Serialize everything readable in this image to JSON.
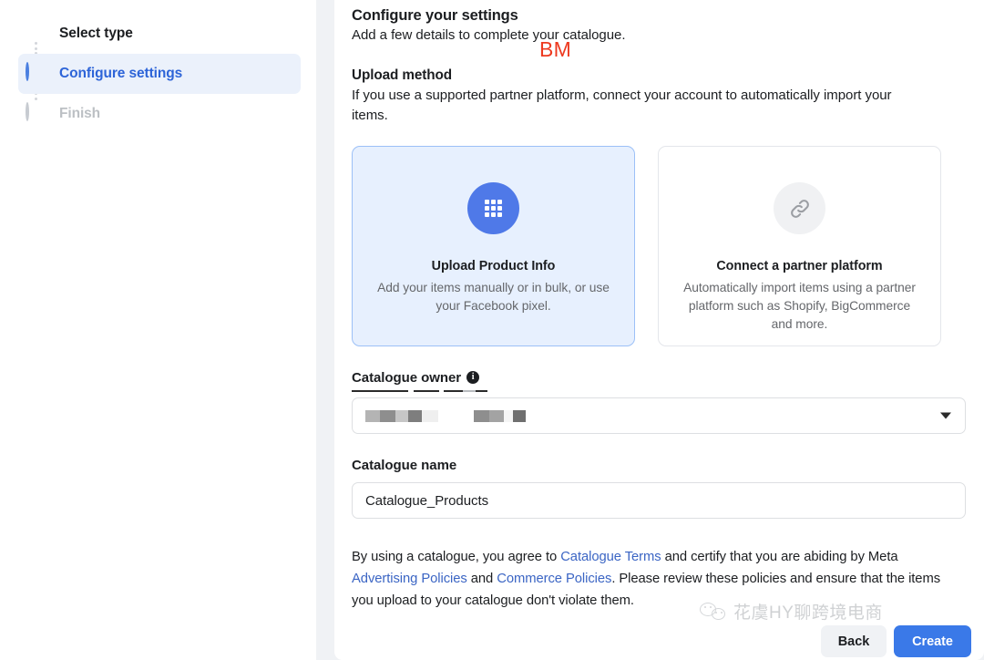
{
  "sidebar": {
    "steps": [
      {
        "label": "Select type",
        "state": "done",
        "icon": "check-circle-icon"
      },
      {
        "label": "Configure settings",
        "state": "active",
        "icon": "half-circle-icon"
      },
      {
        "label": "Finish",
        "state": "pending",
        "icon": "empty-circle-icon"
      }
    ]
  },
  "main": {
    "heading": "Configure your settings",
    "subheading": "Add a few details to complete your catalogue.",
    "upload_method": {
      "title": "Upload method",
      "description": "If you use a supported partner platform, connect your account to automatically import your items.",
      "options": [
        {
          "title": "Upload Product Info",
          "description": "Add your items manually or in bulk, or use your Facebook pixel.",
          "icon": "grid-icon",
          "selected": true
        },
        {
          "title": "Connect a partner platform",
          "description": "Automatically import items using a partner platform such as Shopify, BigCommerce and more.",
          "icon": "link-icon",
          "selected": false
        }
      ]
    },
    "catalogue_owner": {
      "label": "Catalogue owner",
      "info_icon": "info-icon",
      "value": "",
      "value_redacted": true,
      "caret_icon": "chevron-down-icon",
      "annotation": "BM",
      "annotation_color": "#ed3a20"
    },
    "catalogue_name": {
      "label": "Catalogue name",
      "value": "Catalogue_Products",
      "placeholder": "Catalogue name"
    },
    "legal": {
      "part1": "By using a catalogue, you agree to ",
      "link1": "Catalogue Terms",
      "part2": " and certify that you are abiding by Meta ",
      "link2": "Advertising Policies",
      "part3": " and ",
      "link3": "Commerce Policies",
      "part4": ". Please review these policies and ensure that the items you upload to your catalogue don't violate them."
    }
  },
  "footer": {
    "back_label": "Back",
    "create_label": "Create"
  },
  "watermark": {
    "text": "花虞HY聊跨境电商",
    "icon": "wechat-icon"
  }
}
